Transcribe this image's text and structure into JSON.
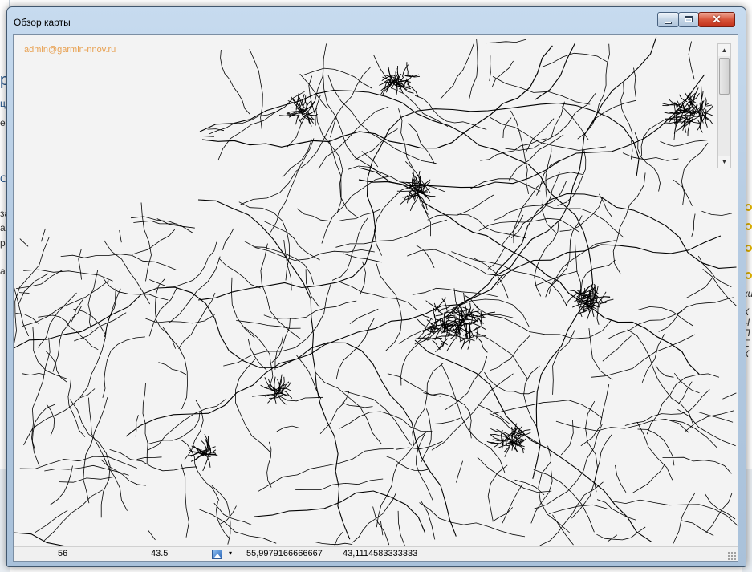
{
  "window": {
    "title": "Обзор карты",
    "controls": {
      "minimize": "",
      "maximize": "",
      "close": "✕"
    }
  },
  "map": {
    "watermark": "admin@garmin-nnov.ru",
    "road_color": "#000000",
    "background_color": "#f3f3f3"
  },
  "scrollbar": {
    "up_arrow": "▲",
    "down_arrow": "▼"
  },
  "statusbar": {
    "zoom": "56",
    "scale": "43.5",
    "layer_icon": "map-layer-icon",
    "dropdown_arrow": "▾",
    "latitude": "55,9979166666667",
    "longitude": "43,1114583333333"
  },
  "background_app": {
    "left_fragments": [
      "р",
      "це",
      "е:",
      "С",
      "за",
      "ач",
      "р",
      "ан"
    ],
    "right_fragments": [
      "ки",
      "К",
      "Ч",
      "П",
      "Е",
      "К"
    ],
    "accent_color": "#e2b400"
  }
}
